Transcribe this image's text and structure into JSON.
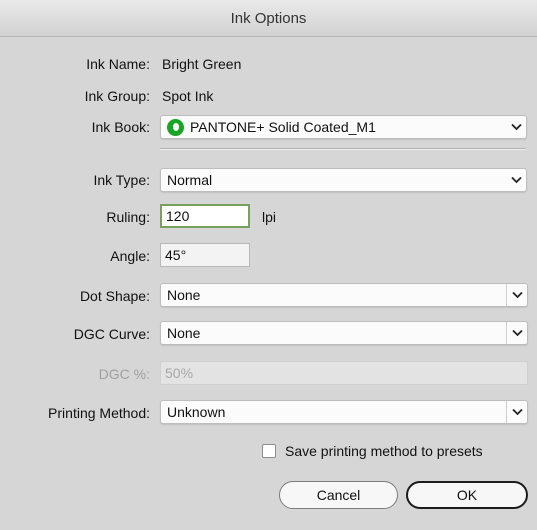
{
  "window": {
    "title": "Ink Options"
  },
  "ink_name": {
    "label": "Ink Name:",
    "value": "Bright Green"
  },
  "ink_group": {
    "label": "Ink Group:",
    "value": "Spot Ink"
  },
  "ink_book": {
    "label": "Ink Book:",
    "value": "PANTONE+ Solid Coated_M1",
    "icon": "pantone-icon",
    "icon_color": "#1aa526"
  },
  "ink_type": {
    "label": "Ink Type:",
    "value": "Normal"
  },
  "ruling": {
    "label": "Ruling:",
    "value": "120",
    "unit": "lpi"
  },
  "angle": {
    "label": "Angle:",
    "value": "45°"
  },
  "dot_shape": {
    "label": "Dot Shape:",
    "value": "None"
  },
  "dgc_curve": {
    "label": "DGC Curve:",
    "value": "None"
  },
  "dgc_percent": {
    "label": "DGC %:",
    "value": "50%"
  },
  "printing_method": {
    "label": "Printing Method:",
    "value": "Unknown"
  },
  "save_presets": {
    "label": "Save printing method to presets",
    "checked": false
  },
  "buttons": {
    "cancel": "Cancel",
    "ok": "OK"
  }
}
